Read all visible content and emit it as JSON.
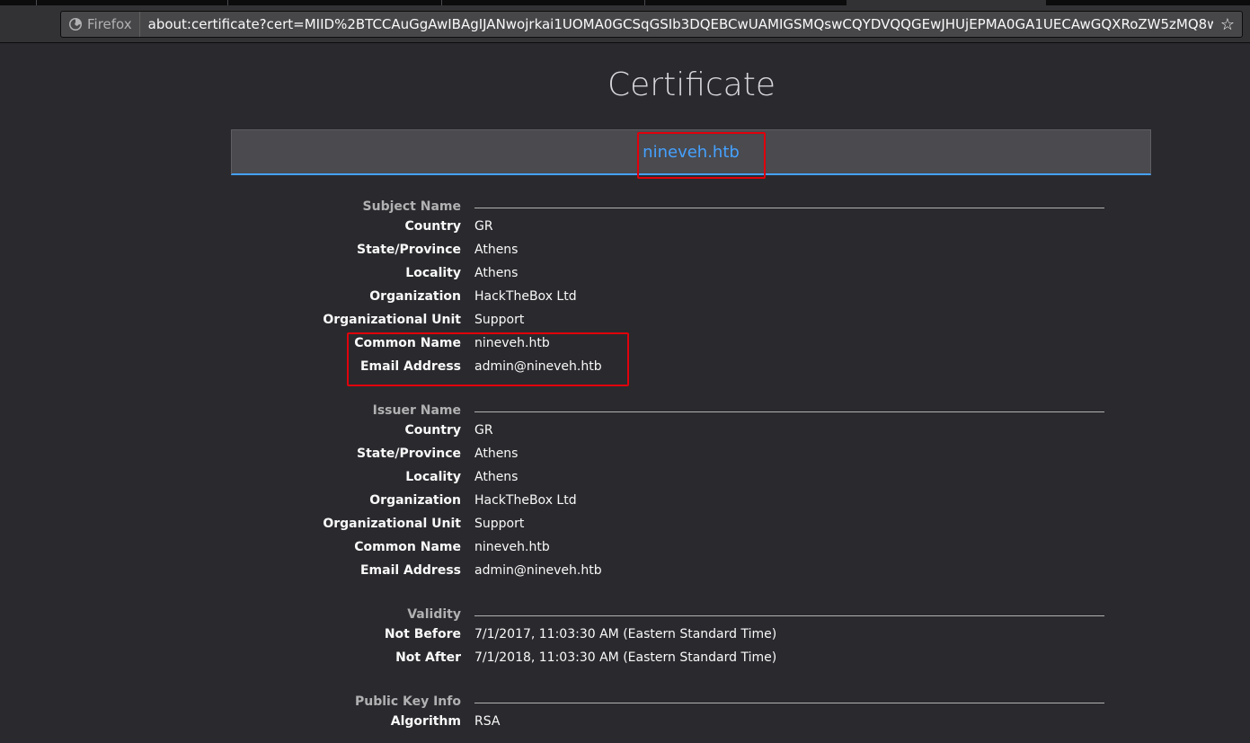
{
  "browser": {
    "identity_label": "Firefox",
    "url": "about:certificate?cert=MIID%2BTCCAuGgAwIBAgIJANwojrkai1UOMA0GCSqGSIb3DQEBCwUAMIGSMQswCQYDVQQGEwJHUjEPMA0GA1UECAwGQXRoZW5zMQ8wDQ",
    "icons": {
      "identity": "firefox-icon",
      "bookmark": "star-icon"
    }
  },
  "page": {
    "title": "Certificate",
    "active_tab": "nineveh.htb"
  },
  "subject": {
    "heading": "Subject Name",
    "rows": [
      {
        "label": "Country",
        "value": "GR"
      },
      {
        "label": "State/Province",
        "value": "Athens"
      },
      {
        "label": "Locality",
        "value": "Athens"
      },
      {
        "label": "Organization",
        "value": "HackTheBox Ltd"
      },
      {
        "label": "Organizational Unit",
        "value": "Support"
      },
      {
        "label": "Common Name",
        "value": "nineveh.htb"
      },
      {
        "label": "Email Address",
        "value": "admin@nineveh.htb"
      }
    ]
  },
  "issuer": {
    "heading": "Issuer Name",
    "rows": [
      {
        "label": "Country",
        "value": "GR"
      },
      {
        "label": "State/Province",
        "value": "Athens"
      },
      {
        "label": "Locality",
        "value": "Athens"
      },
      {
        "label": "Organization",
        "value": "HackTheBox Ltd"
      },
      {
        "label": "Organizational Unit",
        "value": "Support"
      },
      {
        "label": "Common Name",
        "value": "nineveh.htb"
      },
      {
        "label": "Email Address",
        "value": "admin@nineveh.htb"
      }
    ]
  },
  "validity": {
    "heading": "Validity",
    "rows": [
      {
        "label": "Not Before",
        "value": "7/1/2017, 11:03:30 AM (Eastern Standard Time)"
      },
      {
        "label": "Not After",
        "value": "7/1/2018, 11:03:30 AM (Eastern Standard Time)"
      }
    ]
  },
  "public_key": {
    "heading": "Public Key Info",
    "rows": [
      {
        "label": "Algorithm",
        "value": "RSA"
      }
    ]
  },
  "colors": {
    "background": "#2a2a2e",
    "accent": "#45a1ff",
    "highlight": "#e0000b"
  }
}
